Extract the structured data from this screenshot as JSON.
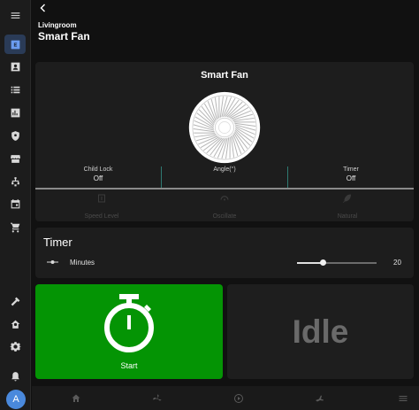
{
  "header": {
    "room": "Livingroom",
    "title": "Smart Fan"
  },
  "sidebar": {
    "avatar_letter": "A",
    "items": [
      {
        "icon": "menu-icon"
      },
      {
        "icon": "dashboard-icon",
        "active": true
      },
      {
        "icon": "person-card-icon"
      },
      {
        "icon": "list-icon"
      },
      {
        "icon": "chart-icon"
      },
      {
        "icon": "shield-icon"
      },
      {
        "icon": "storefront-icon"
      },
      {
        "icon": "hierarchy-icon"
      },
      {
        "icon": "calendar-icon"
      },
      {
        "icon": "cart-icon"
      },
      {
        "icon": "hammer-icon"
      },
      {
        "icon": "home-settings-icon"
      },
      {
        "icon": "gear-icon"
      },
      {
        "icon": "bell-icon"
      }
    ]
  },
  "fan_card": {
    "title": "Smart Fan",
    "attributes": [
      {
        "label": "Child Lock",
        "value": "Off"
      },
      {
        "label": "Angle(°)",
        "value": ""
      },
      {
        "label": "Timer",
        "value": "Off"
      }
    ],
    "controls": [
      {
        "label": "Speed Level",
        "icon": "speed-level-icon"
      },
      {
        "label": "Oscillate",
        "icon": "oscillate-icon"
      },
      {
        "label": "Natural",
        "icon": "leaf-icon"
      }
    ]
  },
  "timer_card": {
    "title": "Timer",
    "label": "Minutes",
    "value": "20",
    "slider_fraction": 0.33
  },
  "start_tile": {
    "label": "Start",
    "icon": "stopwatch-icon",
    "color": "#049404"
  },
  "status_tile": {
    "text": "Idle"
  },
  "bottom_nav": {
    "items": [
      "home-icon",
      "fan-icon",
      "play-circle-icon",
      "airplane-icon",
      "menu-icon"
    ]
  },
  "colors": {
    "accent": "#6b9cf0",
    "divider": "#2f7a72"
  }
}
